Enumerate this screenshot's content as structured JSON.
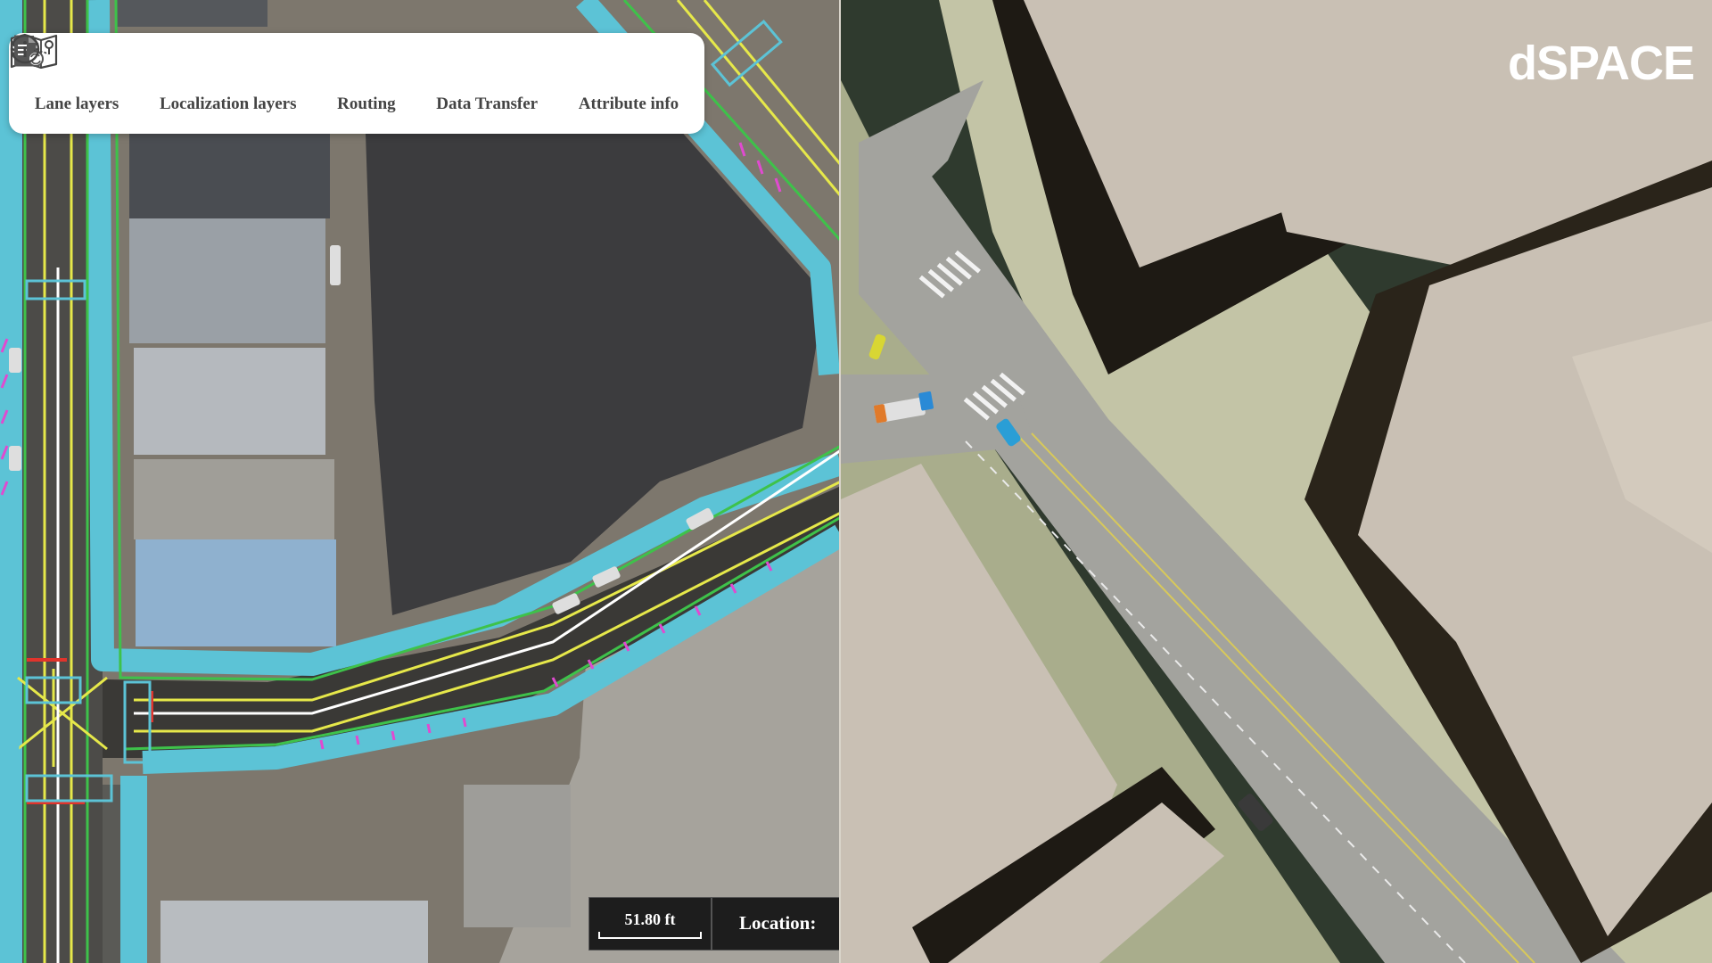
{
  "toolbar": {
    "items": [
      {
        "label": "Lane layers",
        "icon": "layers-icon"
      },
      {
        "label": "Localization layers",
        "icon": "signpost-icon"
      },
      {
        "label": "Routing",
        "icon": "map-route-icon"
      },
      {
        "label": "Data Transfer",
        "icon": "file-sync-icon"
      },
      {
        "label": "Attribute info",
        "icon": "info-icon"
      }
    ]
  },
  "map": {
    "scale_label": "51.80 ft",
    "location_label": "Location:"
  },
  "brand": {
    "name": "dSPACE"
  },
  "colors": {
    "sidewalk": "#5cc3d6",
    "lane_yellow": "#e6e84a",
    "lane_green": "#3ec24a",
    "lane_white": "#ffffff",
    "marker_pink": "#e04ad0",
    "building_3d": "#c9c0b4",
    "road_3d": "#a3a39e"
  }
}
